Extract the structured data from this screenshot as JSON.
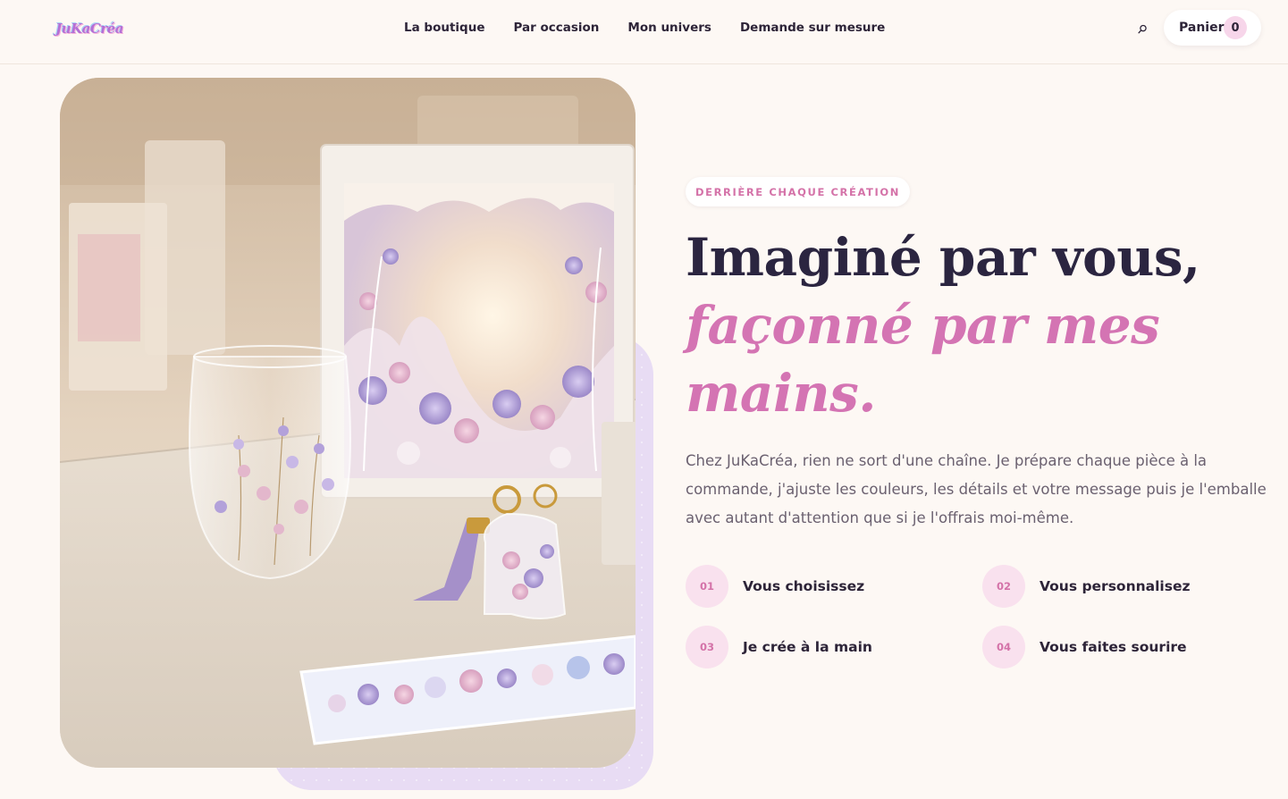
{
  "brand": {
    "logo_text": "JuKaCréa"
  },
  "nav": {
    "items": [
      {
        "label": "La boutique"
      },
      {
        "label": "Par occasion"
      },
      {
        "label": "Mon univers"
      },
      {
        "label": "Demande sur mesure"
      }
    ]
  },
  "header": {
    "search_icon": "search-icon",
    "cart_label": "Panier",
    "cart_count": "0"
  },
  "hero": {
    "eyebrow": "DERRIÈRE CHAQUE CRÉATION",
    "headline_line1": "Imaginé par vous,",
    "headline_accent": "façonné par mes mains.",
    "intro": "Chez JuKaCréa, rien ne sort d'une chaîne. Je prépare chaque pièce à la commande, j'ajuste les couleurs, les détails et votre message puis je l'emballe avec autant d'attention que si je l'offrais moi-même.",
    "steps": [
      {
        "num": "01",
        "label": "Vous choisissez"
      },
      {
        "num": "02",
        "label": "Vous personnalisez"
      },
      {
        "num": "03",
        "label": "Je crée à la main"
      },
      {
        "num": "04",
        "label": "Vous faites sourire"
      }
    ]
  },
  "colors": {
    "background": "#fdf8f4",
    "accent_pink": "#d474b3",
    "heading": "#2b2540",
    "body_text": "#6b6170",
    "lavender": "#e8dcf4",
    "step_bubble": "#f9e1ee"
  }
}
